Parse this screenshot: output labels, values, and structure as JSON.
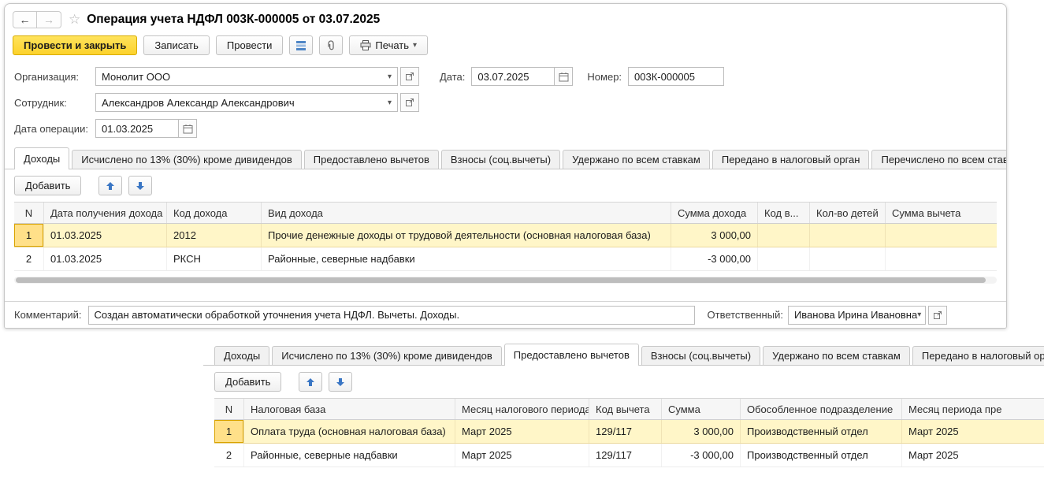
{
  "window": {
    "title": "Операция учета НДФЛ 003К-000005 от 03.07.2025"
  },
  "toolbar": {
    "post_and_close": "Провести и закрыть",
    "write": "Записать",
    "post": "Провести",
    "print": "Печать"
  },
  "fields": {
    "organization": {
      "label": "Организация:",
      "value": "Монолит ООО"
    },
    "date": {
      "label": "Дата:",
      "value": "03.07.2025"
    },
    "number": {
      "label": "Номер:",
      "value": "003К-000005"
    },
    "employee": {
      "label": "Сотрудник:",
      "value": "Александров Александр Александрович"
    },
    "operation_date": {
      "label": "Дата операции:",
      "value": "01.03.2025"
    }
  },
  "tabs_main": [
    "Доходы",
    "Исчислено по 13% (30%) кроме дивидендов",
    "Предоставлено вычетов",
    "Взносы (соц.вычеты)",
    "Удержано по всем ставкам",
    "Передано в налоговый орган",
    "Перечислено по всем ставкам"
  ],
  "income_table": {
    "add_button": "Добавить",
    "headers": [
      "N",
      "Дата получения дохода",
      "Код дохода",
      "Вид дохода",
      "Сумма дохода",
      "Код в...",
      "Кол-во детей",
      "Сумма вычета"
    ],
    "rows": [
      [
        "1",
        "01.03.2025",
        "2012",
        "Прочие денежные доходы от трудовой деятельности (основная налоговая база)",
        "3 000,00",
        "",
        "",
        ""
      ],
      [
        "2",
        "01.03.2025",
        "РКСН",
        "Районные, северные надбавки",
        "-3 000,00",
        "",
        "",
        ""
      ]
    ]
  },
  "footer": {
    "comment_label": "Комментарий:",
    "comment_value": "Создан автоматически обработкой уточнения учета НДФЛ. Вычеты. Доходы.",
    "responsible_label": "Ответственный:",
    "responsible_value": "Иванова Ирина Ивановна"
  },
  "panel2": {
    "tabs": [
      "Доходы",
      "Исчислено по 13% (30%) кроме дивидендов",
      "Предоставлено вычетов",
      "Взносы (соц.вычеты)",
      "Удержано по всем ставкам",
      "Передано в налоговый орган"
    ],
    "add_button": "Добавить",
    "headers": [
      "N",
      "Налоговая база",
      "Месяц налогового периода",
      "Код вычета",
      "Сумма",
      "Обособленное подразделение",
      "Месяц периода пре"
    ],
    "rows": [
      [
        "1",
        "Оплата труда (основная налоговая база)",
        "Март 2025",
        "129/117",
        "3 000,00",
        "Производственный отдел",
        "Март 2025"
      ],
      [
        "2",
        "Районные, северные надбавки",
        "Март 2025",
        "129/117",
        "-3 000,00",
        "Производственный отдел",
        "Март 2025"
      ]
    ]
  },
  "colors": {
    "accent-yellow": "#fcd22c",
    "accent-yellow-dark": "#d9ad00",
    "selected-row": "#fff6c8",
    "current-cell": "#ffe089",
    "current-cell-border": "#d9a300",
    "blue-icon": "#3a76c4",
    "tab-border": "#c8c8c8",
    "header-bg": "#f6f6f6"
  }
}
